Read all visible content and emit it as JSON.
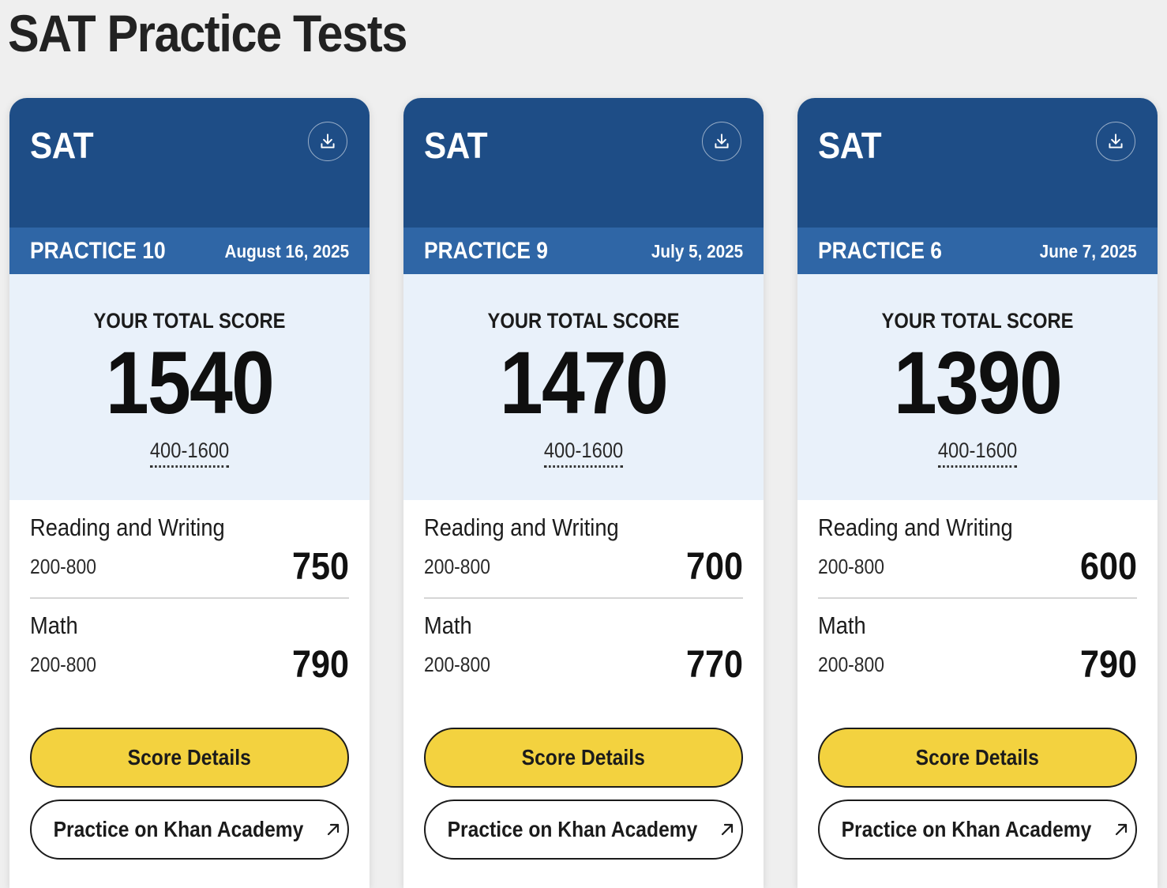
{
  "page": {
    "title": "SAT Practice Tests"
  },
  "cards": [
    {
      "exam": "SAT",
      "practice": "PRACTICE 10",
      "date": "August 16, 2025",
      "total_caption": "YOUR TOTAL SCORE",
      "total_score": "1540",
      "total_range": "400-1600",
      "sections": [
        {
          "name": "Reading and Writing",
          "range": "200-800",
          "score": "750"
        },
        {
          "name": "Math",
          "range": "200-800",
          "score": "790"
        }
      ],
      "score_details_label": "Score Details",
      "khan_label": "Practice on Khan Academy"
    },
    {
      "exam": "SAT",
      "practice": "PRACTICE 9",
      "date": "July 5, 2025",
      "total_caption": "YOUR TOTAL SCORE",
      "total_score": "1470",
      "total_range": "400-1600",
      "sections": [
        {
          "name": "Reading and Writing",
          "range": "200-800",
          "score": "700"
        },
        {
          "name": "Math",
          "range": "200-800",
          "score": "770"
        }
      ],
      "score_details_label": "Score Details",
      "khan_label": "Practice on Khan Academy"
    },
    {
      "exam": "SAT",
      "practice": "PRACTICE 6",
      "date": "June 7, 2025",
      "total_caption": "YOUR TOTAL SCORE",
      "total_score": "1390",
      "total_range": "400-1600",
      "sections": [
        {
          "name": "Reading and Writing",
          "range": "200-800",
          "score": "600"
        },
        {
          "name": "Math",
          "range": "200-800",
          "score": "790"
        }
      ],
      "score_details_label": "Score Details",
      "khan_label": "Practice on Khan Academy"
    }
  ],
  "icons": {
    "download": "download-icon",
    "external": "external-link-arrow-icon"
  },
  "colors": {
    "header_dark_blue": "#1e4d86",
    "header_mid_blue": "#2f66a6",
    "score_panel_bg": "#e9f1fa",
    "primary_button_yellow": "#f3d23f",
    "page_bg": "#efefef"
  }
}
